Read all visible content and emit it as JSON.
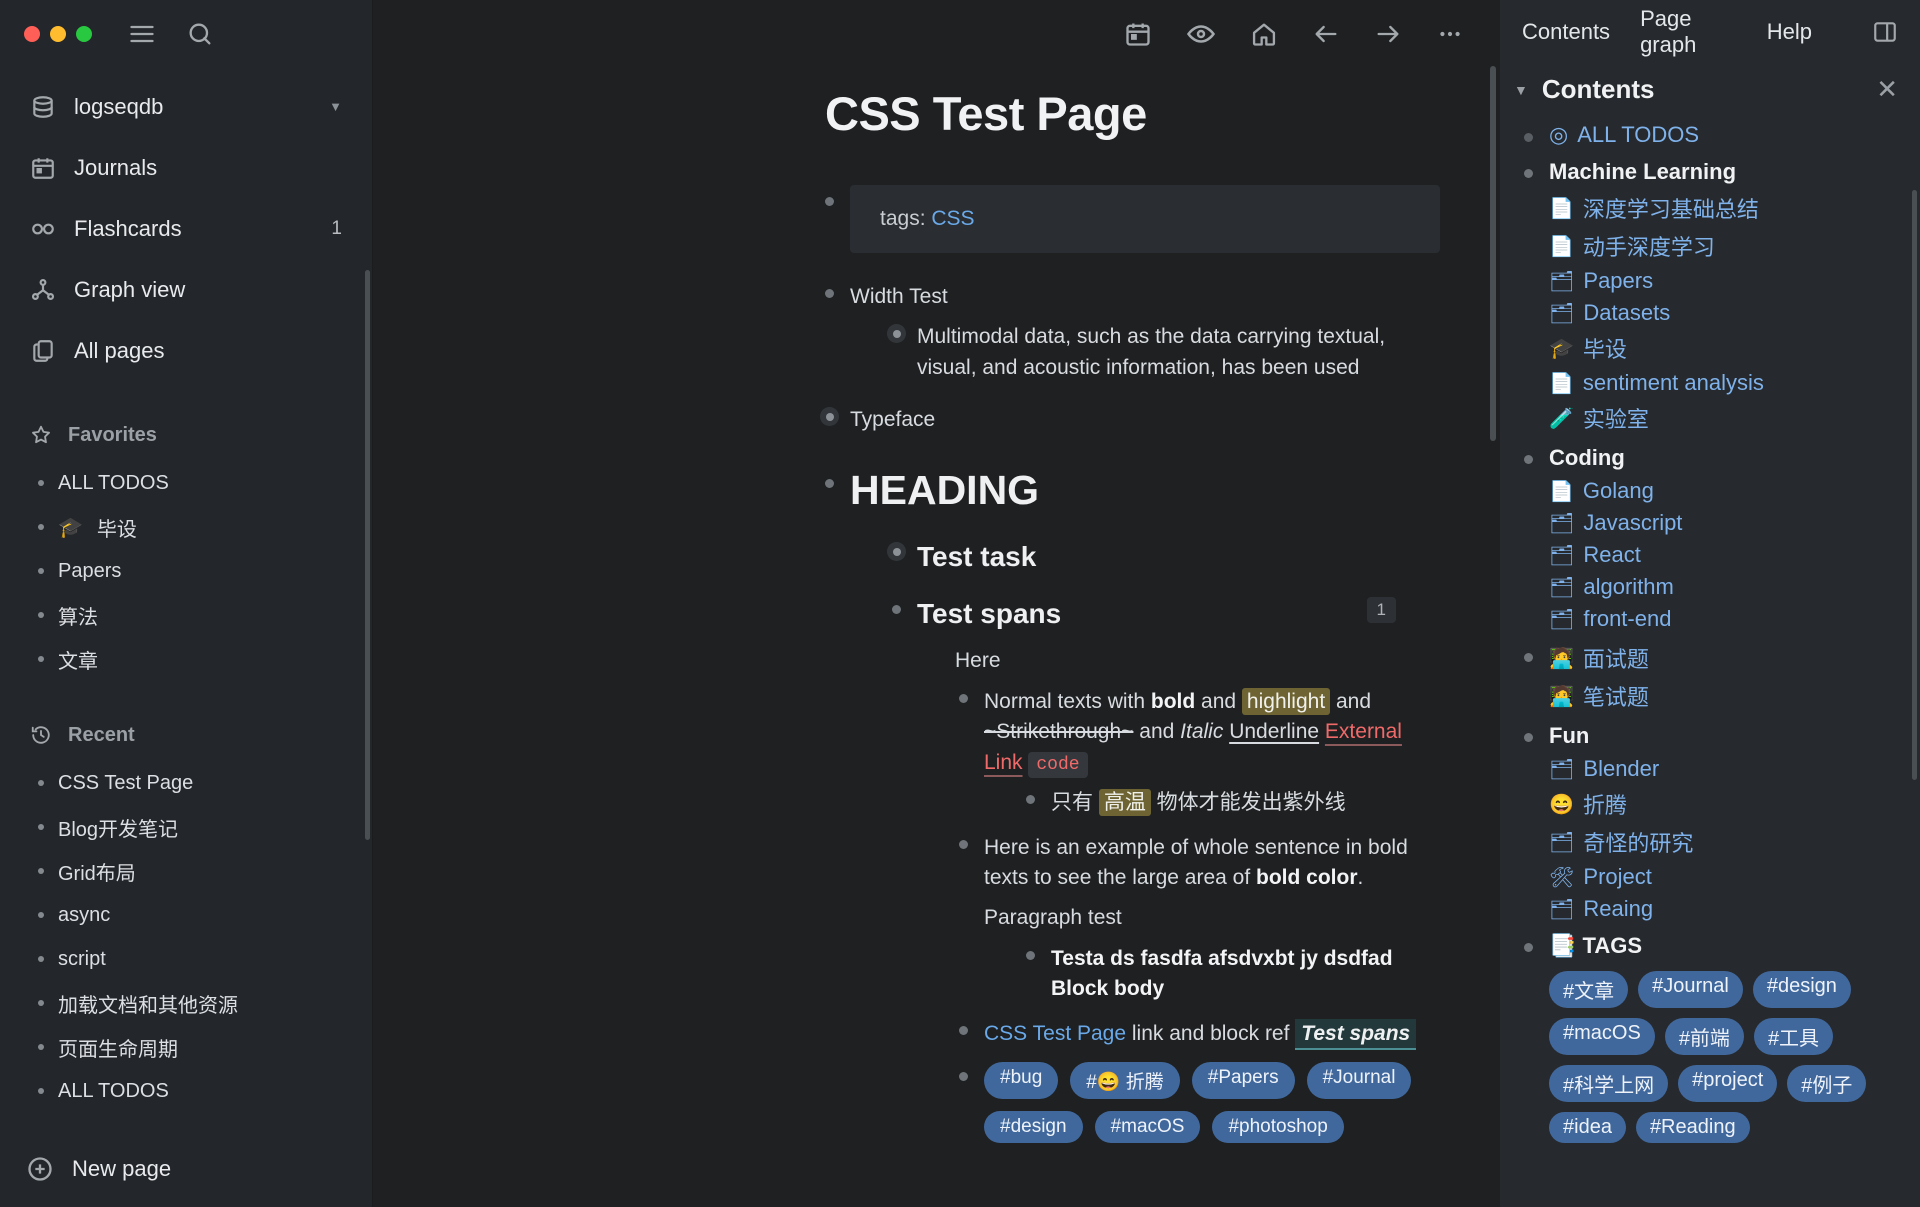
{
  "window": {
    "traffic_lights": [
      "close",
      "minimize",
      "maximize"
    ],
    "menu_icon": "hamburger-icon",
    "search_icon": "search-icon"
  },
  "sidebar": {
    "graph_name": "logseqdb",
    "nav": [
      {
        "label": "Journals",
        "icon": "calendar-icon",
        "count": ""
      },
      {
        "label": "Flashcards",
        "icon": "infinity-icon",
        "count": "1"
      },
      {
        "label": "Graph view",
        "icon": "graph-icon",
        "count": ""
      },
      {
        "label": "All pages",
        "icon": "pages-icon",
        "count": ""
      }
    ],
    "favorites": {
      "title": "Favorites",
      "icon": "star-icon",
      "items": [
        {
          "label": "ALL TODOS",
          "emoji": ""
        },
        {
          "label": "毕设",
          "emoji": "🎓"
        },
        {
          "label": "Papers",
          "emoji": ""
        },
        {
          "label": "算法",
          "emoji": ""
        },
        {
          "label": "文章",
          "emoji": ""
        }
      ]
    },
    "recent": {
      "title": "Recent",
      "icon": "history-icon",
      "items": [
        {
          "label": "CSS Test Page"
        },
        {
          "label": "Blog开发笔记"
        },
        {
          "label": "Grid布局"
        },
        {
          "label": "async"
        },
        {
          "label": "script"
        },
        {
          "label": "加载文档和其他资源"
        },
        {
          "label": "页面生命周期"
        },
        {
          "label": "ALL TODOS"
        }
      ],
      "more": "· · · · ··"
    },
    "new_page": {
      "label": "New page",
      "icon": "plus-circle-icon"
    }
  },
  "toolbar": {
    "icons": [
      {
        "name": "calendar-icon"
      },
      {
        "name": "eye-icon"
      },
      {
        "name": "home-icon"
      },
      {
        "name": "arrow-left-icon"
      },
      {
        "name": "arrow-right-icon"
      },
      {
        "name": "more-dots-icon"
      }
    ]
  },
  "page": {
    "title": "CSS Test Page",
    "properties": {
      "key": "tags:",
      "value": "CSS"
    },
    "blocks": {
      "width_test": {
        "heading": "Width Test",
        "child": "Multimodal data, such as the data carrying textual, visual, and acoustic information, has been used"
      },
      "typeface": "Typeface",
      "heading_big": "HEADING",
      "test_task": "Test task",
      "test_spans": "Test spans",
      "ref_count": "1",
      "here": "Here",
      "spans_line": {
        "t1": "Normal texts with ",
        "bold": "bold",
        "t2": " and ",
        "highlight": "highlight",
        "t3": " and ",
        "strike": "~Strikethrough~",
        "t4": " and ",
        "italic": "Italic",
        "underline": "Underline",
        "space": " ",
        "extlink": "External Link",
        "code": "code"
      },
      "chinese_line": {
        "pre": "只有 ",
        "hl": "高温",
        "post": " 物体才能发出紫外线"
      },
      "bold_example": {
        "normal": "Here is an example of whole sentence in bold texts to see the large area of ",
        "bold": "bold color",
        "tail": ".",
        "paragraph": "Paragraph test",
        "child_bold": "Testa ds fasdfa afsdvxbt jy dsdfad Block body"
      },
      "link_block_ref": {
        "pagelink": "CSS Test Page",
        "mid": " link and block ref ",
        "blockref": "Test spans"
      },
      "tags": [
        "#bug",
        "#😄 折腾",
        "#Papers",
        "#Journal",
        "#design",
        "#macOS",
        "#photoshop"
      ]
    }
  },
  "right_sidebar": {
    "tabs": [
      "Contents",
      "Page graph",
      "Help"
    ],
    "toggle_icon": "sidebar-toggle-icon",
    "panel_title": "Contents",
    "close_icon": "close-icon",
    "all_todos": {
      "emoji": "◎",
      "label": "ALL TODOS"
    },
    "sections": [
      {
        "title": "Machine Learning",
        "items": [
          {
            "emoji": "📄",
            "label": "深度学习基础总结"
          },
          {
            "emoji": "📄",
            "label": "动手深度学习"
          },
          {
            "emoji": "🗂",
            "label": "Papers"
          },
          {
            "emoji": "🗂",
            "label": "Datasets"
          },
          {
            "emoji": "🎓",
            "label": "毕设"
          },
          {
            "emoji": "📄",
            "label": "sentiment analysis"
          },
          {
            "emoji": "🧪",
            "label": "实验室"
          }
        ]
      },
      {
        "title": "Coding",
        "items": [
          {
            "emoji": "📄",
            "label": "Golang"
          },
          {
            "emoji": "🗂",
            "label": "Javascript"
          },
          {
            "emoji": "🗂",
            "label": "React"
          },
          {
            "emoji": "🗂",
            "label": "algorithm"
          },
          {
            "emoji": "🗂",
            "label": "front-end"
          }
        ]
      },
      {
        "title": "",
        "items": [
          {
            "emoji": "🧑‍💻",
            "label": "面试题"
          },
          {
            "emoji": "🧑‍💻",
            "label": "笔试题"
          }
        ]
      },
      {
        "title": "Fun",
        "items": [
          {
            "emoji": "🗂",
            "label": "Blender"
          },
          {
            "emoji": "😄",
            "label": "折腾"
          },
          {
            "emoji": "🗂",
            "label": "奇怪的研究"
          },
          {
            "emoji": "🛠",
            "label": "Project"
          },
          {
            "emoji": "🗂",
            "label": "Reaing"
          }
        ]
      }
    ],
    "tags_section": {
      "emoji": "📑",
      "title": "TAGS",
      "tags": [
        "#文章",
        "#Journal",
        "#design",
        "#macOS",
        "#前端",
        "#工具",
        "#科学上网",
        "#project",
        "#例子",
        "#idea",
        "#Reading"
      ]
    }
  },
  "colors": {
    "bg": "#1e2022",
    "sidebar_bg": "#23262a",
    "right_bg": "#26292d",
    "link": "#6aa9e9",
    "tag": "#41689c",
    "highlight": "#6e6433",
    "code_red": "#f16a6a"
  }
}
